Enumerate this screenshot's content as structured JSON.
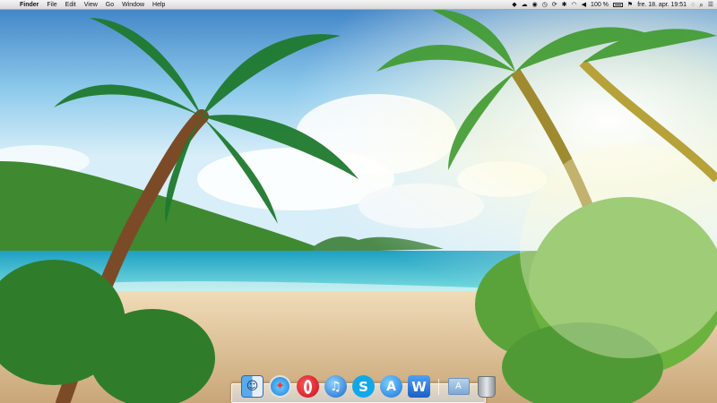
{
  "menubar": {
    "apple_symbol": "",
    "app_name": "Finder",
    "menus": [
      "File",
      "Edit",
      "View",
      "Go",
      "Window",
      "Help"
    ],
    "status": {
      "battery_text": "100 %",
      "clock": "fre. 18. apr.  19:51"
    }
  },
  "dock": {
    "apps": [
      {
        "name": "finder-icon",
        "glyph": "☺"
      },
      {
        "name": "safari-icon",
        "glyph": "✦"
      },
      {
        "name": "opera-icon",
        "glyph": ""
      },
      {
        "name": "itunes-icon",
        "glyph": "♫"
      },
      {
        "name": "skype-icon",
        "glyph": "S"
      },
      {
        "name": "app-store-icon",
        "glyph": "A"
      },
      {
        "name": "word-icon",
        "glyph": "W"
      }
    ],
    "apps_folder_glyph": "A"
  },
  "colors": {
    "sky": "#7fc3e6",
    "sea": "#3fc6d6",
    "sand": "#e7cfa6"
  }
}
